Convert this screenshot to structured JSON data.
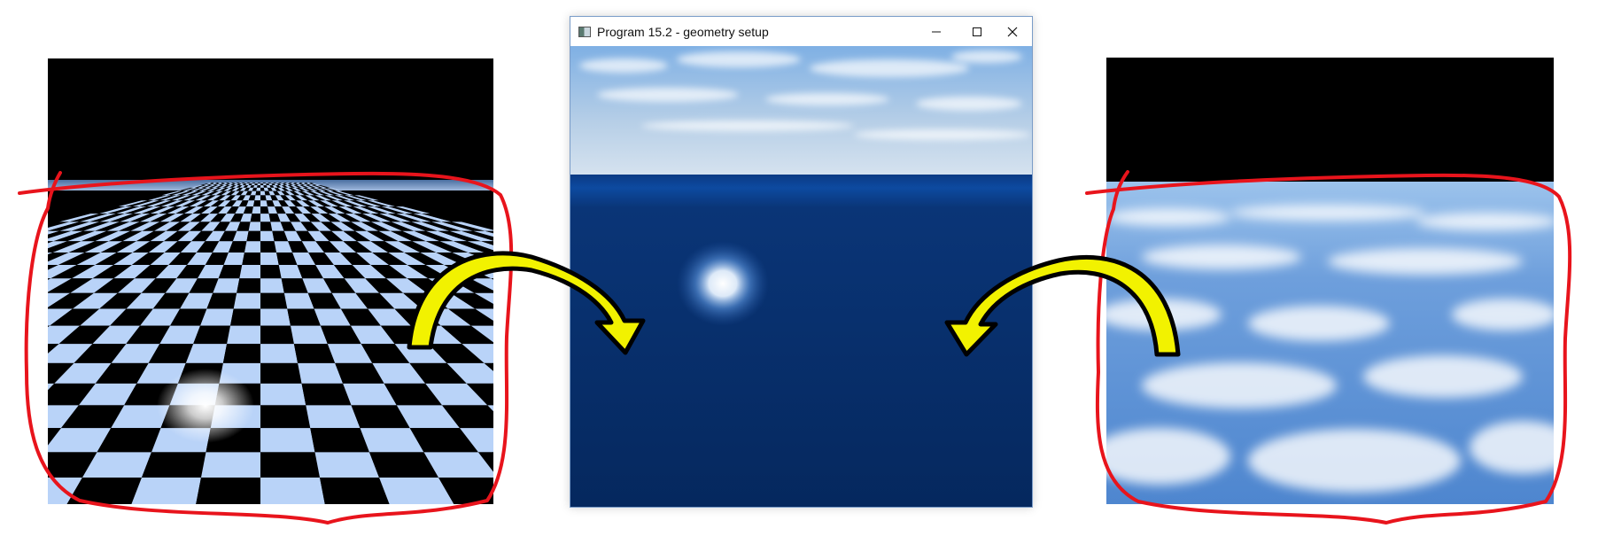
{
  "window": {
    "title": "Program 15.2 - geometry setup",
    "controls": [
      "minimize-icon",
      "maximize-icon",
      "close-icon"
    ]
  },
  "scenes": {
    "left": "checkerboard-floor",
    "center": "sky-and-ocean",
    "right": "cloudy-sky"
  },
  "colors": {
    "annotation_outline": "#e8141c",
    "arrow_fill": "#f2f200",
    "arrow_stroke": "#000000",
    "ocean": "#0a2f6e",
    "checker_light": "#b9d3f8"
  }
}
